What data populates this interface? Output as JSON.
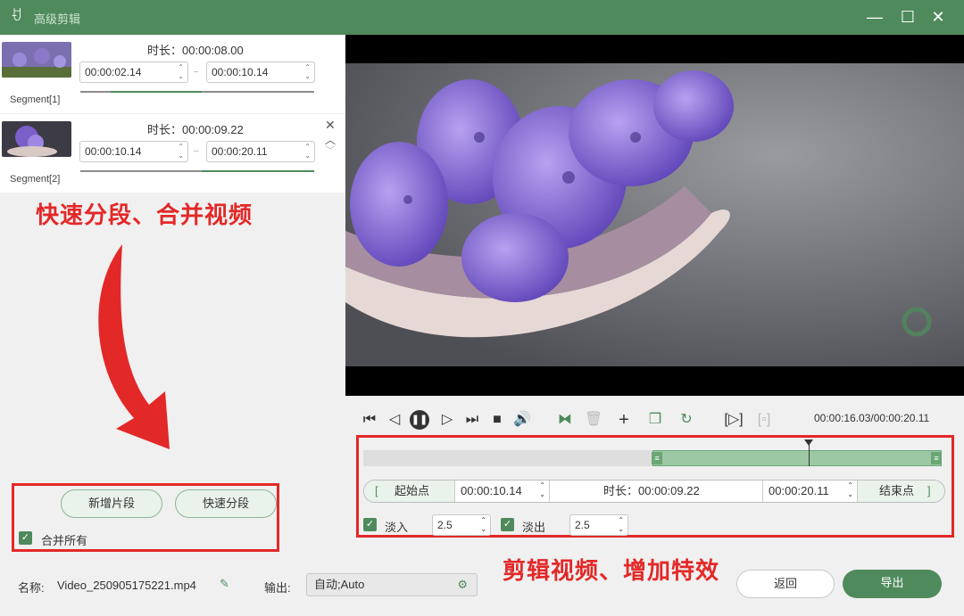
{
  "window": {
    "title": "高级剪辑",
    "minimize": "—",
    "maximize": "☐",
    "close": "✕"
  },
  "segments": [
    {
      "label": "Segment[1]",
      "duration_label": "时长：00:00:08.00",
      "start": "00:00:02.14",
      "end": "00:00:10.14",
      "progress_start": 0.13,
      "progress_end": 0.52
    },
    {
      "label": "Segment[2]",
      "duration_label": "时长：00:00:09.22",
      "start": "00:00:10.14",
      "end": "00:00:20.11",
      "progress_start": 0.52,
      "progress_end": 1.0
    }
  ],
  "annotations": {
    "top": "快速分段、合并视频",
    "bottom": "剪辑视频、增加特效"
  },
  "left_actions": {
    "add_segment": "新增片段",
    "quick_split": "快速分段",
    "merge_all": "合并所有"
  },
  "player": {
    "timecode": "00:00:16.03/00:00:20.11"
  },
  "trim": {
    "start_point": "起始点",
    "start_bracket": "[",
    "start_time": "00:00:10.14",
    "duration": "时长：00:00:09.22",
    "end_time": "00:00:20.11",
    "end_point": "结束点",
    "end_bracket": "]",
    "selection_start": 0.5,
    "selection_end": 1.0,
    "playhead": 0.77
  },
  "effects": {
    "fade_in_label": "淡入",
    "fade_in_value": "2.5",
    "fade_out_label": "淡出",
    "fade_out_value": "2.5"
  },
  "bottom": {
    "name_label": "名称:",
    "filename": "Video_250905175221.mp4",
    "output_label": "输出:",
    "output_value": "自动;Auto",
    "back_button": "返回",
    "export_button": "导出"
  },
  "colors": {
    "accent": "#4f8a5c",
    "annotation": "#e32828"
  }
}
